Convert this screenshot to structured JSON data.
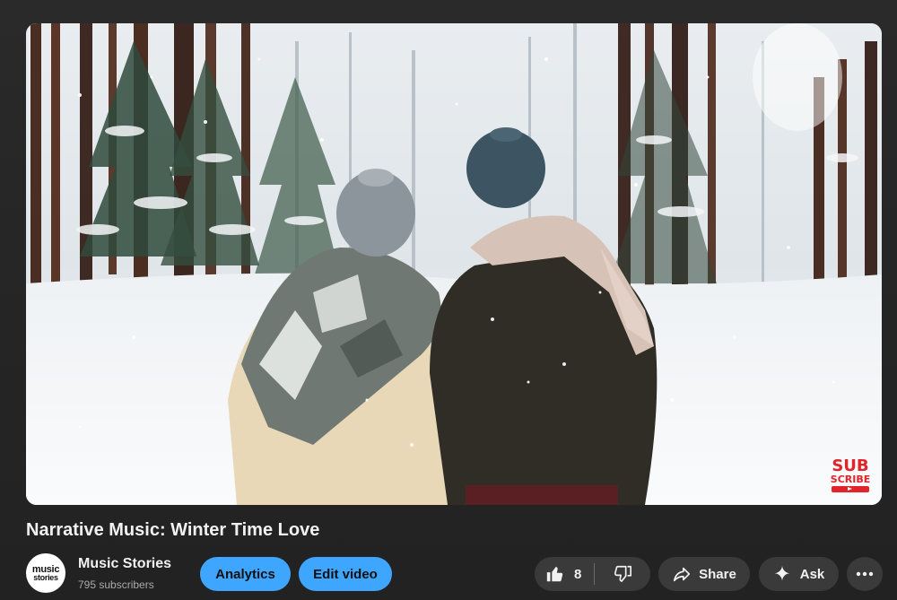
{
  "video": {
    "title": "Narrative Music: Winter Time Love",
    "watermark_line1": "SUB",
    "watermark_line2": "SCRIBE"
  },
  "channel": {
    "name": "Music Stories",
    "subscribers": "795 subscribers",
    "avatar_line1": "music",
    "avatar_line2": "stories"
  },
  "actions": {
    "analytics_label": "Analytics",
    "edit_label": "Edit video",
    "like_count": "8",
    "share_label": "Share",
    "ask_label": "Ask"
  },
  "icons": {
    "like": "thumbs-up-icon",
    "dislike": "thumbs-down-icon",
    "share": "share-arrow-icon",
    "ask": "sparkle-icon",
    "more": "more-horizontal-icon"
  },
  "colors": {
    "accent_blue": "#3ea6ff",
    "button_gray": "#3a3a3a",
    "background": "#262626",
    "watermark_red": "#e2232a"
  }
}
